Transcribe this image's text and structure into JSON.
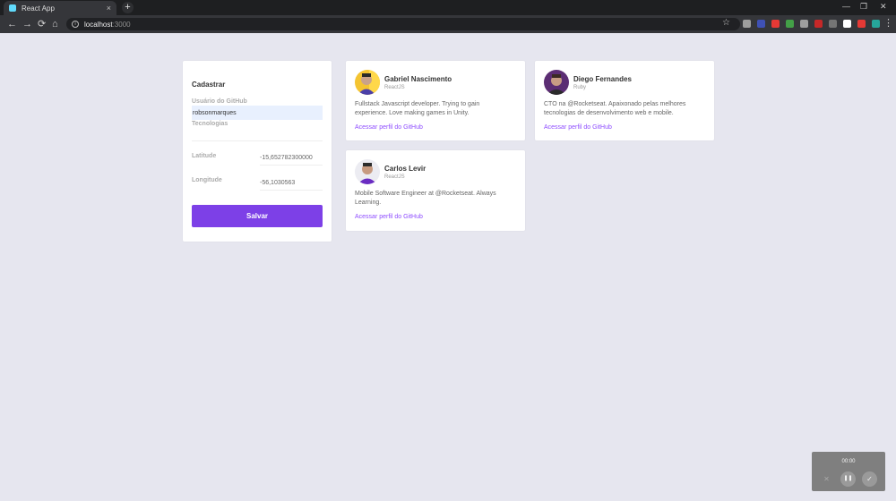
{
  "browser": {
    "tab_title": "React App",
    "tab_close": "×",
    "new_tab": "+",
    "url_host": "localhost",
    "url_port": ":3000",
    "nav_back": "←",
    "nav_forward": "→",
    "nav_reload": "⟳",
    "nav_home": "⌂",
    "star": "☆",
    "menu": "⋮",
    "window_controls": {
      "minimize": "—",
      "maximize": "❐",
      "close": "✕"
    },
    "extension_colors": [
      "#9e9e9e",
      "#3f51b5",
      "#e53935",
      "#43a047",
      "#9e9e9e",
      "#c62828",
      "#757575",
      "#ffffff",
      "#e53935",
      "#26a69a"
    ]
  },
  "form": {
    "title": "Cadastrar",
    "github_label": "Usuário do GitHub",
    "github_value": "robsonmarques",
    "techs_label": "Tecnologias",
    "techs_value": "",
    "latitude_label": "Latitude",
    "latitude_value": "-15,652782300000",
    "longitude_label": "Longitude",
    "longitude_value": "-56,1030563",
    "save_label": "Salvar",
    "accent_color": "#7d40e7"
  },
  "devs": [
    {
      "name": "Gabriel Nascimento",
      "techs": "ReactJS",
      "bio": "Fullstack Javascript developer. Trying to gain experience. Love making games in Unity.",
      "link": "Acessar perfil do GitHub"
    },
    {
      "name": "Diego Fernandes",
      "techs": "Ruby",
      "bio": "CTO na @Rocketseat. Apaixonado pelas melhores tecnologias de desenvolvimento web e mobile.",
      "link": "Acessar perfil do GitHub"
    },
    {
      "name": "Carlos Levir",
      "techs": "ReactJS",
      "bio": "Mobile Software Engineer at @Rocketseat. Always Learning.",
      "link": "Acessar perfil do GitHub"
    }
  ],
  "recorder": {
    "time": "00:00",
    "cancel_icon": "✕",
    "pause_icon": "❚❚",
    "done_icon": "✓"
  }
}
